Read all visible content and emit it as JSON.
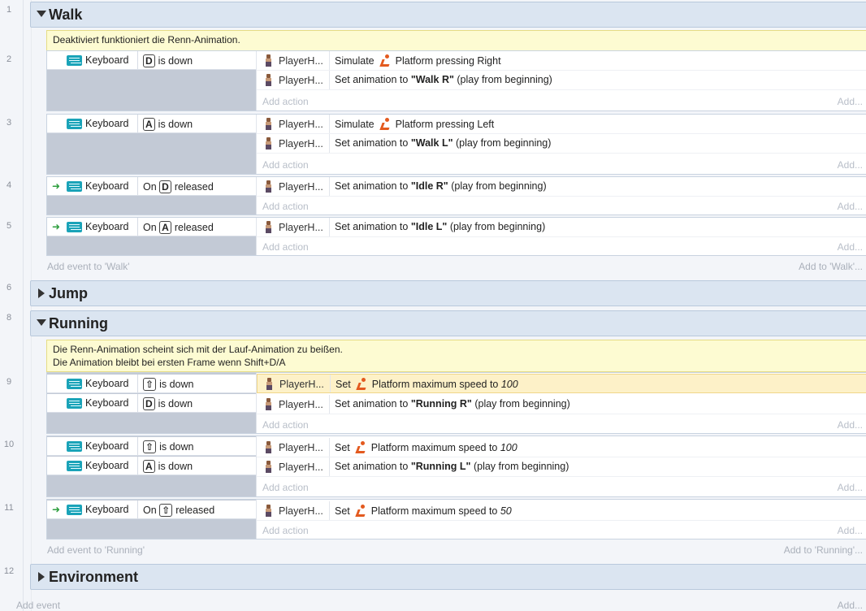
{
  "line_numbers": [
    "1",
    "2",
    "3",
    "4",
    "5",
    "6",
    "8",
    "9",
    "10",
    "11",
    "12"
  ],
  "groups": {
    "walk": "Walk",
    "jump": "Jump",
    "running": "Running",
    "environment": "Environment"
  },
  "comments": {
    "walk": "Deaktiviert funktioniert die Renn-Animation.",
    "running_1": "Die Renn-Animation scheint sich mit der Lauf-Animation zu beißen.",
    "running_2": "Die Animation bleibt bei ersten Frame wenn Shift+D/A"
  },
  "labels": {
    "keyboard": "Keyboard",
    "is_down": "is down",
    "on": "On",
    "released": "released",
    "player": "PlayerH...",
    "simulate": "Simulate",
    "set": "Set",
    "set_anim": "Set animation to",
    "play_from_beginning": "(play from beginning)",
    "platform_pressing_right": "Platform pressing Right",
    "platform_pressing_left": "Platform pressing Left",
    "platform_max_speed": "Platform maximum speed to",
    "add_action": "Add action",
    "add_short": "Add...",
    "add_event_walk": "Add event to 'Walk'",
    "add_to_walk": "Add to 'Walk'...",
    "add_event_running": "Add event to 'Running'",
    "add_to_running": "Add to 'Running'...",
    "add_event": "Add event",
    "add_bottom": "Add..."
  },
  "keys": {
    "d": "D",
    "a": "A",
    "shift": "⇧"
  },
  "anims": {
    "walk_r": "\"Walk R\"",
    "walk_l": "\"Walk L\"",
    "idle_r": "\"Idle R\"",
    "idle_l": "\"Idle L\"",
    "running_r": "\"Running R\"",
    "running_l": "\"Running L\""
  },
  "speeds": {
    "s100": "100",
    "s50": "50"
  }
}
